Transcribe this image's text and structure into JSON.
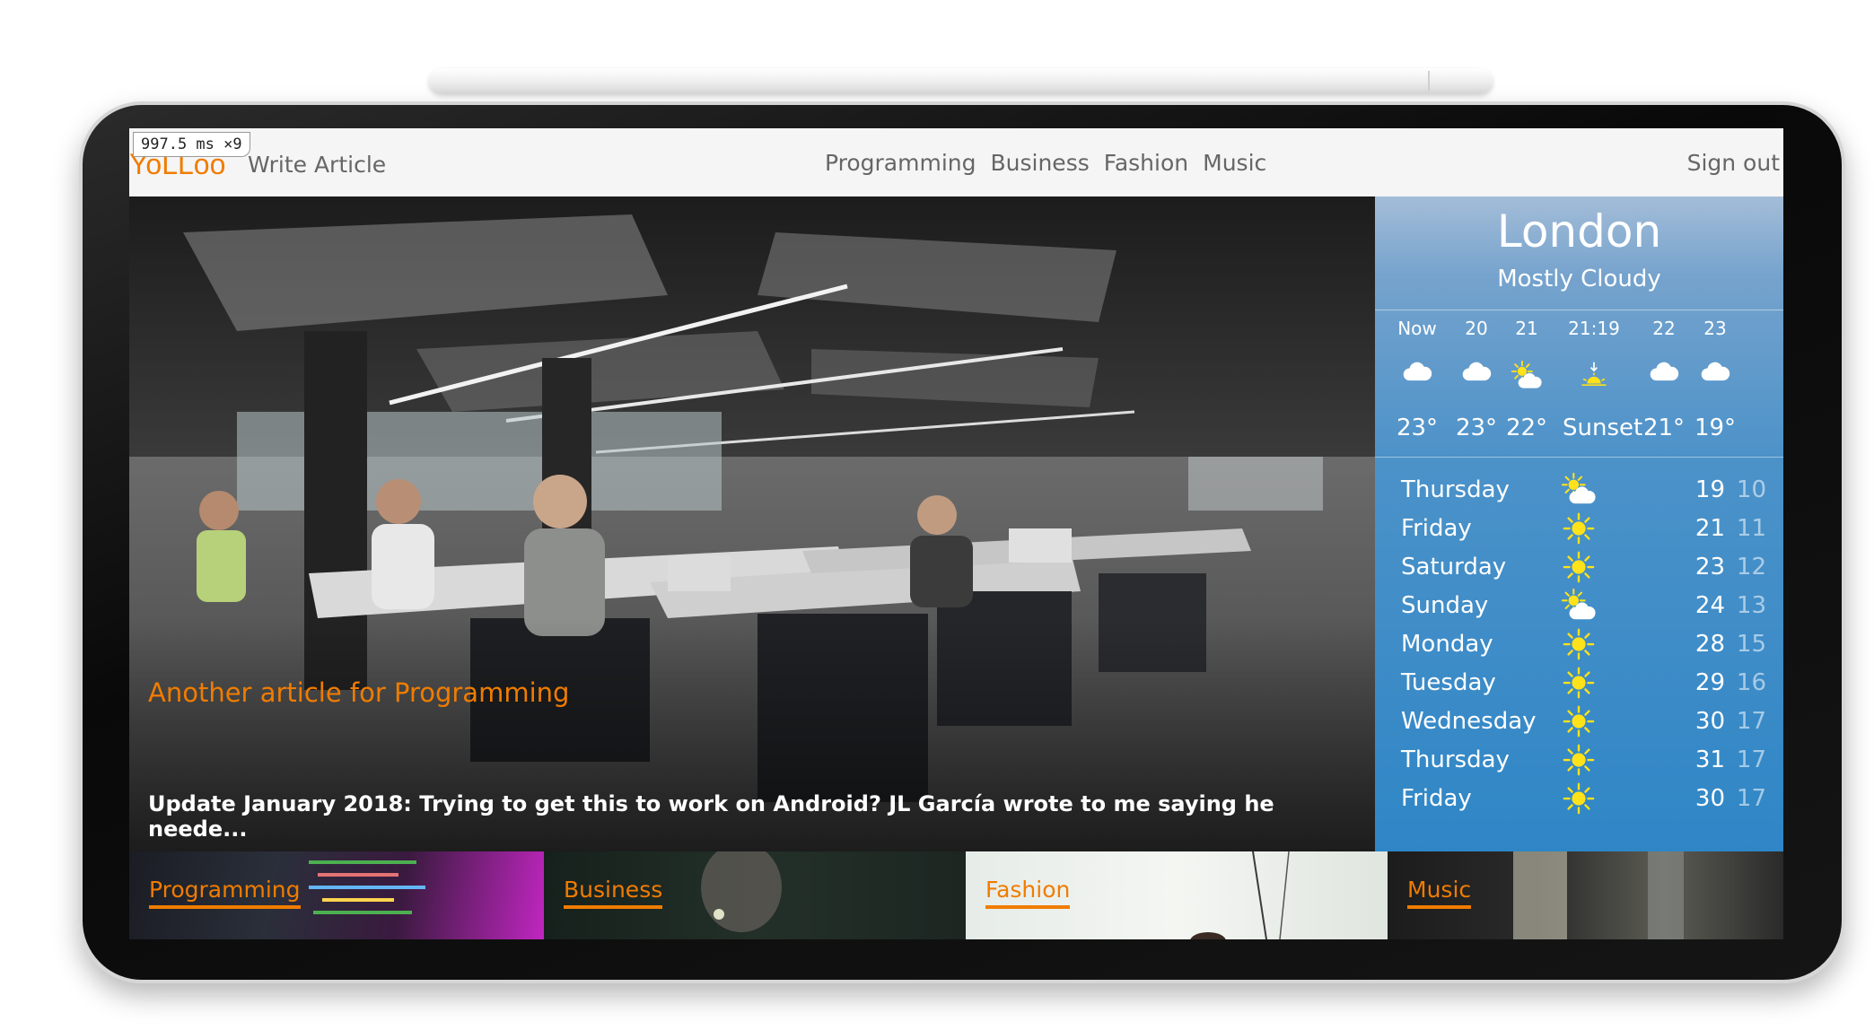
{
  "debug_overlay": "997.5 ms ×9",
  "navbar": {
    "logo": "YoLLoo",
    "write_article": "Write Article",
    "categories": [
      "Programming",
      "Business",
      "Fashion",
      "Music"
    ],
    "sign_out": "Sign out"
  },
  "hero": {
    "title": "Another article for Programming",
    "excerpt": "Update January 2018: Trying to get this to work on Android? JL García wrote to me saying he neede..."
  },
  "weather": {
    "city": "London",
    "condition": "Mostly Cloudy",
    "hourly": [
      {
        "label": "Now",
        "icon": "cloud-icon",
        "temp": "23°"
      },
      {
        "label": "20",
        "icon": "cloud-icon",
        "temp": "23°"
      },
      {
        "label": "21",
        "icon": "partly-sunny-icon",
        "temp": "22°"
      },
      {
        "label": "21:19",
        "icon": "sunset-icon",
        "temp": "Sunset"
      },
      {
        "label": "22",
        "icon": "cloud-icon",
        "temp": "21°"
      },
      {
        "label": "23",
        "icon": "cloud-icon",
        "temp": "19°"
      }
    ],
    "daily": [
      {
        "day": "Thursday",
        "icon": "partly-sunny-icon",
        "high": "19",
        "low": "10"
      },
      {
        "day": "Friday",
        "icon": "sun-icon",
        "high": "21",
        "low": "11"
      },
      {
        "day": "Saturday",
        "icon": "sun-icon",
        "high": "23",
        "low": "12"
      },
      {
        "day": "Sunday",
        "icon": "partly-sunny-icon",
        "high": "24",
        "low": "13"
      },
      {
        "day": "Monday",
        "icon": "sun-icon",
        "high": "28",
        "low": "15"
      },
      {
        "day": "Tuesday",
        "icon": "sun-icon",
        "high": "29",
        "low": "16"
      },
      {
        "day": "Wednesday",
        "icon": "sun-icon",
        "high": "30",
        "low": "17"
      },
      {
        "day": "Thursday",
        "icon": "sun-icon",
        "high": "31",
        "low": "17"
      },
      {
        "day": "Friday",
        "icon": "sun-icon",
        "high": "30",
        "low": "17"
      }
    ]
  },
  "tiles": [
    {
      "label": "Programming"
    },
    {
      "label": "Business"
    },
    {
      "label": "Fashion"
    },
    {
      "label": "Music"
    }
  ],
  "colors": {
    "accent": "#f07c00",
    "navbar_bg": "#f5f5f5",
    "nav_text": "#666666",
    "weather_sky": "#2f86c6"
  }
}
